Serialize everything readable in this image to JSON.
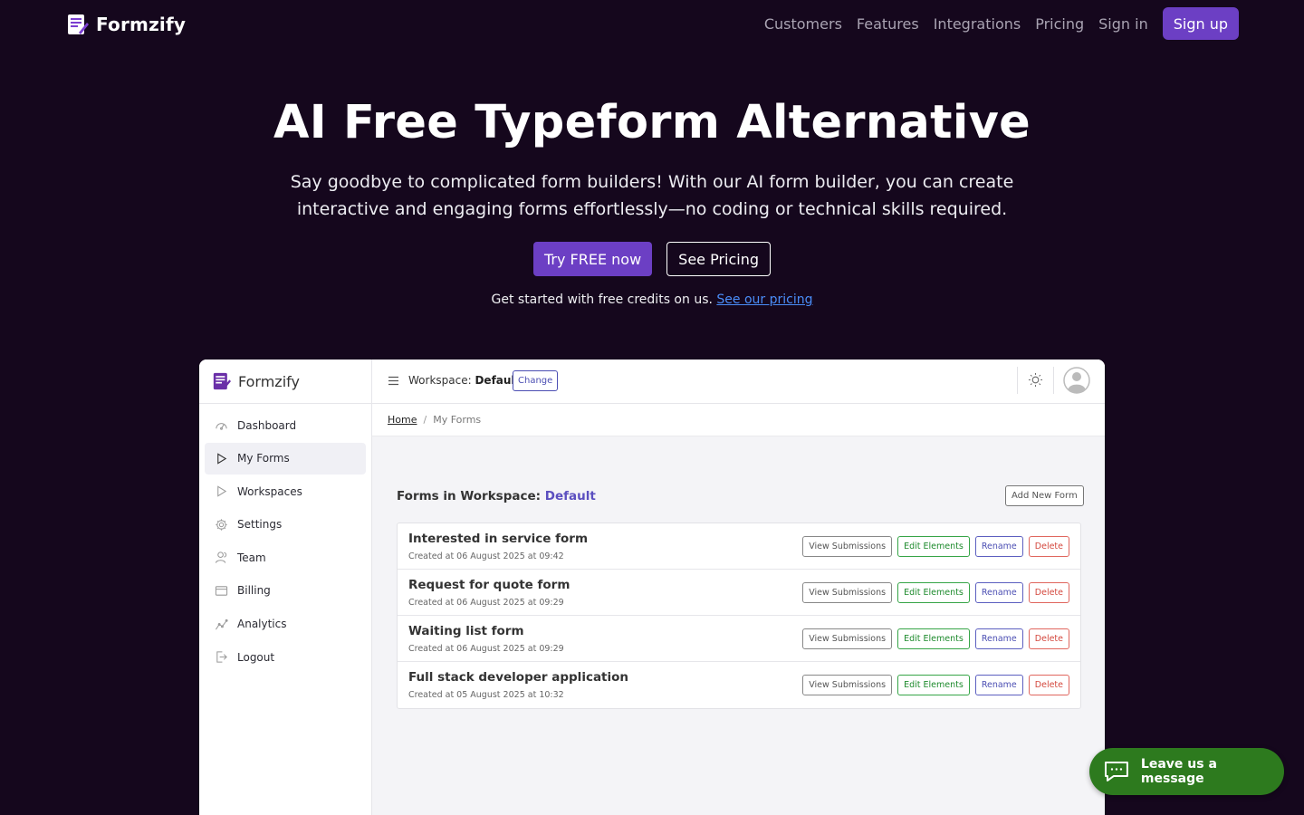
{
  "nav": {
    "brand": "Formzify",
    "links": [
      "Customers",
      "Features",
      "Integrations",
      "Pricing",
      "Sign in"
    ],
    "signup": "Sign up"
  },
  "hero": {
    "title": "AI Free Typeform Alternative",
    "subtitle": "Say goodbye to complicated form builders! With our AI form builder, you can create interactive and engaging forms effortlessly—no coding or technical skills required.",
    "primary_cta": "Try FREE now",
    "secondary_cta": "See Pricing",
    "credits_text": "Get started with free credits on us.",
    "credits_link": "See our pricing"
  },
  "app": {
    "brand": "Formzify",
    "sidebar": [
      {
        "label": "Dashboard",
        "icon": "dashboard-icon"
      },
      {
        "label": "My Forms",
        "icon": "play-icon"
      },
      {
        "label": "Workspaces",
        "icon": "play-icon"
      },
      {
        "label": "Settings",
        "icon": "gear-icon"
      },
      {
        "label": "Team",
        "icon": "team-icon"
      },
      {
        "label": "Billing",
        "icon": "billing-icon"
      },
      {
        "label": "Analytics",
        "icon": "analytics-icon"
      },
      {
        "label": "Logout",
        "icon": "logout-icon"
      }
    ],
    "topbar": {
      "workspace_prefix": "Workspace:",
      "workspace_name": "Default",
      "change": "Change"
    },
    "breadcrumb": {
      "home": "Home",
      "sep": "/",
      "current": "My Forms"
    },
    "forms_heading_prefix": "Forms in Workspace:",
    "forms_heading_ws": "Default",
    "add_form": "Add New Form",
    "actions": {
      "view": "View Submissions",
      "edit": "Edit Elements",
      "rename": "Rename",
      "delete": "Delete"
    },
    "forms": [
      {
        "title": "Interested in service form",
        "date": "Created at 06 August 2025 at 09:42"
      },
      {
        "title": "Request for quote form",
        "date": "Created at 06 August 2025 at 09:29"
      },
      {
        "title": "Waiting list form",
        "date": "Created at 06 August 2025 at 09:29"
      },
      {
        "title": "Full stack developer application",
        "date": "Created at 05 August 2025 at 10:32"
      }
    ]
  },
  "chat": {
    "label": "Leave us a message"
  },
  "colors": {
    "accent": "#6c3fc4",
    "background": "#15071d",
    "chat": "#2d7a1e"
  }
}
